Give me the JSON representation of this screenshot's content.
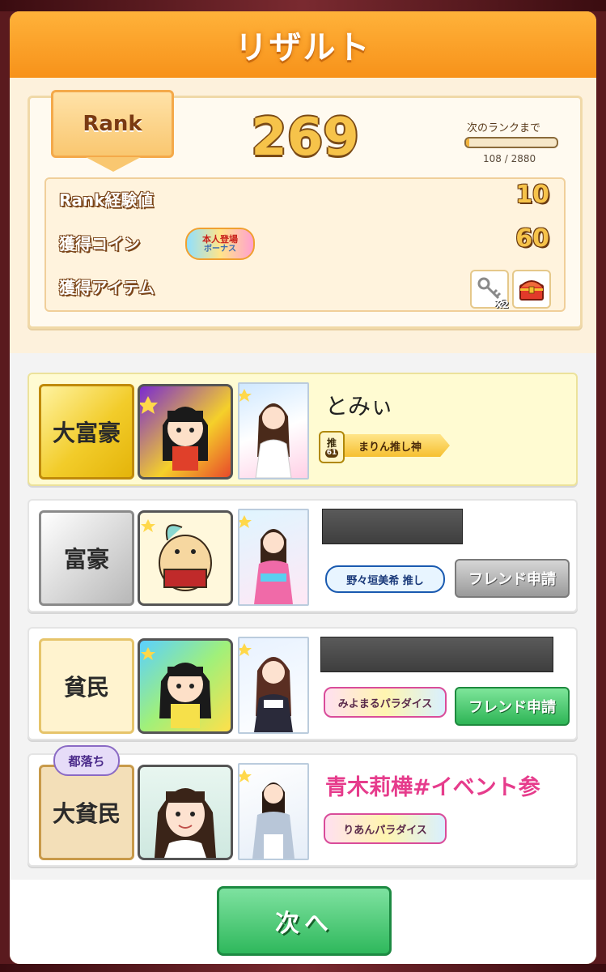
{
  "header": {
    "title": "リザルト"
  },
  "rank": {
    "label": "Rank",
    "value": "269",
    "next_label": "次のランクまで",
    "progress_text": "108 / 2880",
    "progress_fraction": 0.0375
  },
  "rewards": {
    "exp_label": "Rank経験値",
    "exp_value": "10",
    "coin_label": "獲得コイン",
    "coin_value": "60",
    "bonus_line1": "本人登場",
    "bonus_line2": "ボーナス",
    "item_label": "獲得アイテム",
    "items": [
      {
        "icon": "key-icon",
        "count": "x2"
      },
      {
        "icon": "treasure-chest-icon",
        "count": ""
      }
    ]
  },
  "players": [
    {
      "title": "大富豪",
      "badge_style": "gold",
      "name": "とみぃ",
      "oshi_mark": "推",
      "oshi_level": "61",
      "oshi_title": "まりん推し神",
      "friend_button": ""
    },
    {
      "title": "富豪",
      "badge_style": "silver",
      "name": "",
      "oshi_label": "野々垣美希 推し",
      "friend_button": "フレンド申請"
    },
    {
      "title": "貧民",
      "badge_style": "cream",
      "name": "",
      "oshi_label": "みよまるパラダイス",
      "friend_button": "フレンド申請"
    },
    {
      "title": "大貧民",
      "badge_style": "tan",
      "demoted": "都落ち",
      "name": "青木莉樺#イベント参",
      "oshi_label": "りあんパラダイス",
      "friend_button": ""
    }
  ],
  "footer": {
    "next_label": "次へ"
  },
  "colors": {
    "accent_orange": "#f7921a",
    "button_green": "#2fb85c",
    "name_pink": "#e63c8c"
  }
}
